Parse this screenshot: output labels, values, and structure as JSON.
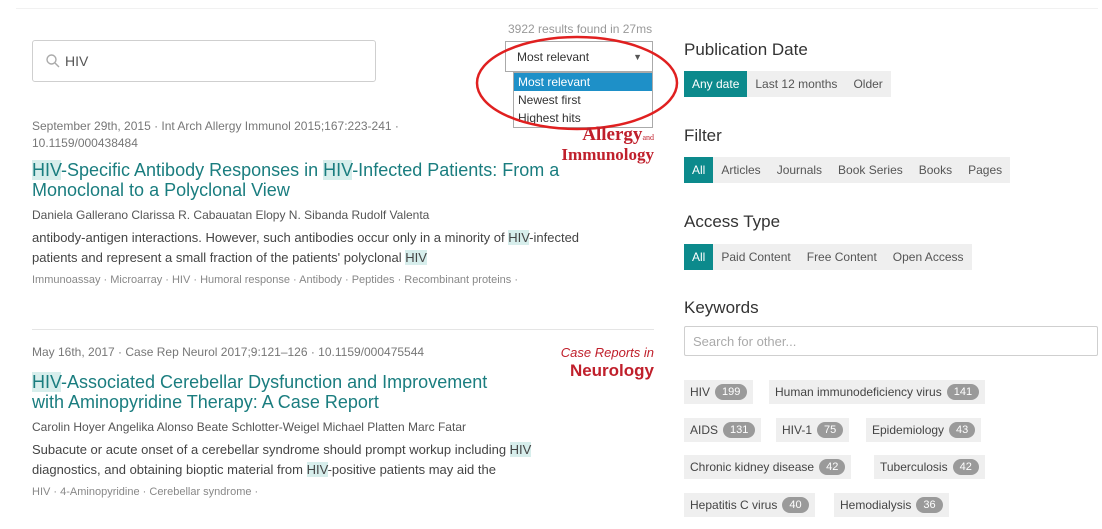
{
  "search": {
    "value": "HIV"
  },
  "results_count": "3922 results found in 27ms",
  "sort": {
    "selected": "Most relevant",
    "options": [
      "Most relevant",
      "Newest first",
      "Highest hits"
    ]
  },
  "results": [
    {
      "meta_line1": "September 29th, 2015 · Int Arch Allergy Immunol 2015;167:223-241 ·",
      "meta_line2": "10.1159/000438484",
      "title_line1_parts": [
        "HIV",
        "-Specific Antibody Responses in ",
        "HIV",
        "-Infected Patients: From a"
      ],
      "title_line2": "Monoclonal to a Polyclonal View",
      "authors": "Daniela Gallerano Clarissa R. Cabauatan Elopy N. Sibanda Rudolf Valenta",
      "snippet_line1_parts": [
        "antibody-antigen interactions. However, such antibodies occur only in a minority of ",
        "HIV",
        "-infected"
      ],
      "snippet_line2_parts": [
        "patients and represent a small fraction of the patients' polyclonal ",
        "HIV"
      ],
      "keywords": "Immunoassay · Microarray · HIV · Humoral response · Antibody · Peptides · Recombinant proteins ·",
      "logo_line1": "Allergy",
      "logo_line1_small": "and",
      "logo_line2": "Immunology"
    },
    {
      "meta_line1": "May 16th, 2017 · Case Rep Neurol 2017;9:121–126 · 10.1159/000475544",
      "title_line1_parts": [
        "HIV",
        "-Associated Cerebellar Dysfunction and Improvement"
      ],
      "title_line2": "with Aminopyridine Therapy: A Case Report",
      "authors": "Carolin Hoyer Angelika Alonso Beate Schlotter-Weigel Michael Platten Marc Fatar",
      "snippet_line1_parts": [
        "Subacute or acute onset of a cerebellar syndrome should prompt workup including ",
        "HIV"
      ],
      "snippet_line2_parts": [
        "diagnostics, and obtaining bioptic material from ",
        "HIV",
        "-positive patients may aid the"
      ],
      "keywords": "HIV · 4-Aminopyridine · Cerebellar syndrome ·",
      "logo_line1": "Case Reports in",
      "logo_line2": "Neurology"
    }
  ],
  "sidebar": {
    "publication_date": {
      "heading": "Publication Date",
      "buttons": [
        "Any date",
        "Last 12 months",
        "Older"
      ]
    },
    "filter": {
      "heading": "Filter",
      "buttons": [
        "All",
        "Articles",
        "Journals",
        "Book Series",
        "Books",
        "Pages"
      ]
    },
    "access_type": {
      "heading": "Access Type",
      "buttons": [
        "All",
        "Paid Content",
        "Free Content",
        "Open Access"
      ]
    },
    "keywords": {
      "heading": "Keywords",
      "placeholder": "Search for other...",
      "tags": [
        {
          "label": "HIV",
          "count": "199"
        },
        {
          "label": "Human immunodeficiency virus",
          "count": "141"
        },
        {
          "label": "AIDS",
          "count": "131"
        },
        {
          "label": "HIV-1",
          "count": "75"
        },
        {
          "label": "Epidemiology",
          "count": "43"
        },
        {
          "label": "Chronic kidney disease",
          "count": "42"
        },
        {
          "label": "Tuberculosis",
          "count": "42"
        },
        {
          "label": "Hepatitis C virus",
          "count": "40"
        },
        {
          "label": "Hemodialysis",
          "count": "36"
        }
      ]
    }
  },
  "colors": {
    "accent": "#0c8a8c",
    "link": "#1a7d7f",
    "highlight": "#d7eeec",
    "annotation": "#e02020"
  }
}
